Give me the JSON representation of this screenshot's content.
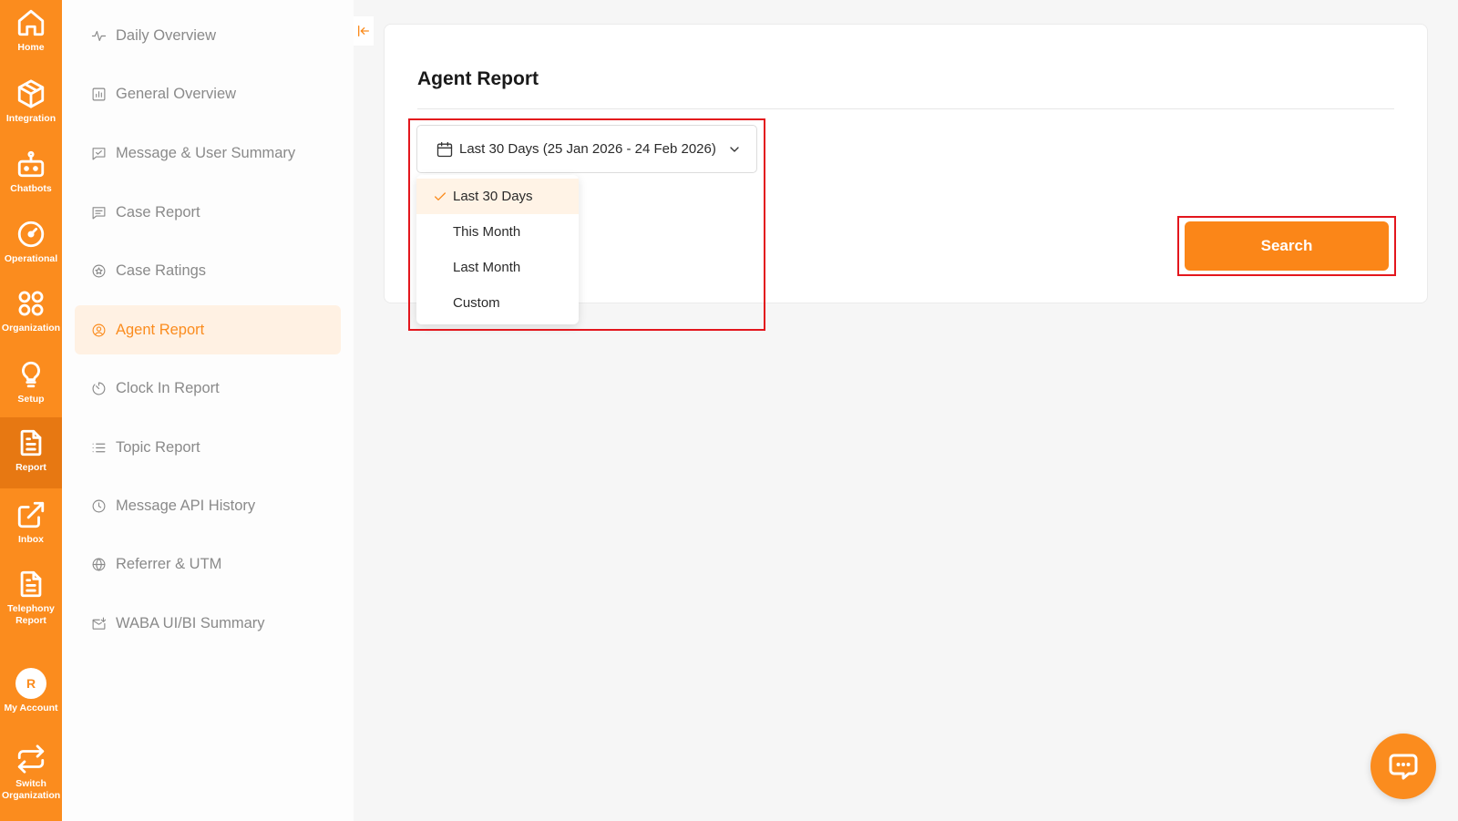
{
  "rail": {
    "items": [
      {
        "label": "Home",
        "icon": "home-icon"
      },
      {
        "label": "Integration",
        "icon": "package-icon"
      },
      {
        "label": "Chatbots",
        "icon": "robot-icon"
      },
      {
        "label": "Operational",
        "icon": "gauge-icon"
      },
      {
        "label": "Organization",
        "icon": "grid-circles-icon"
      },
      {
        "label": "Setup",
        "icon": "lightbulb-icon"
      },
      {
        "label": "Report",
        "icon": "document-icon",
        "active": true
      },
      {
        "label": "Inbox",
        "icon": "external-link-icon"
      },
      {
        "label": "Telephony Report",
        "icon": "document-icon"
      },
      {
        "label": "My Account",
        "avatar": "R"
      },
      {
        "label": "Switch Organization",
        "icon": "swap-icon"
      }
    ]
  },
  "sidebar": {
    "items": [
      {
        "label": "Daily Overview",
        "icon": "pulse-icon"
      },
      {
        "label": "General Overview",
        "icon": "bar-chart-icon"
      },
      {
        "label": "Message & User Summary",
        "icon": "message-check-icon"
      },
      {
        "label": "Case Report",
        "icon": "message-lines-icon"
      },
      {
        "label": "Case Ratings",
        "icon": "star-circle-icon"
      },
      {
        "label": "Agent Report",
        "icon": "user-circle-icon",
        "active": true
      },
      {
        "label": "Clock In Report",
        "icon": "timer-icon"
      },
      {
        "label": "Topic Report",
        "icon": "list-icon"
      },
      {
        "label": "Message API History",
        "icon": "clock-icon"
      },
      {
        "label": "Referrer & UTM",
        "icon": "globe-icon"
      },
      {
        "label": "WABA UI/BI Summary",
        "icon": "mail-in-icon"
      }
    ]
  },
  "main": {
    "title": "Agent Report",
    "date_range": {
      "value": "Last 30 Days (25 Jan 2026 - 24 Feb 2026)",
      "options": [
        "Last 30 Days",
        "This Month",
        "Last Month",
        "Custom"
      ],
      "selected_index": 0
    },
    "search_label": "Search"
  },
  "colors": {
    "accent": "#fb8c1e",
    "highlight_border": "#e3161d"
  }
}
